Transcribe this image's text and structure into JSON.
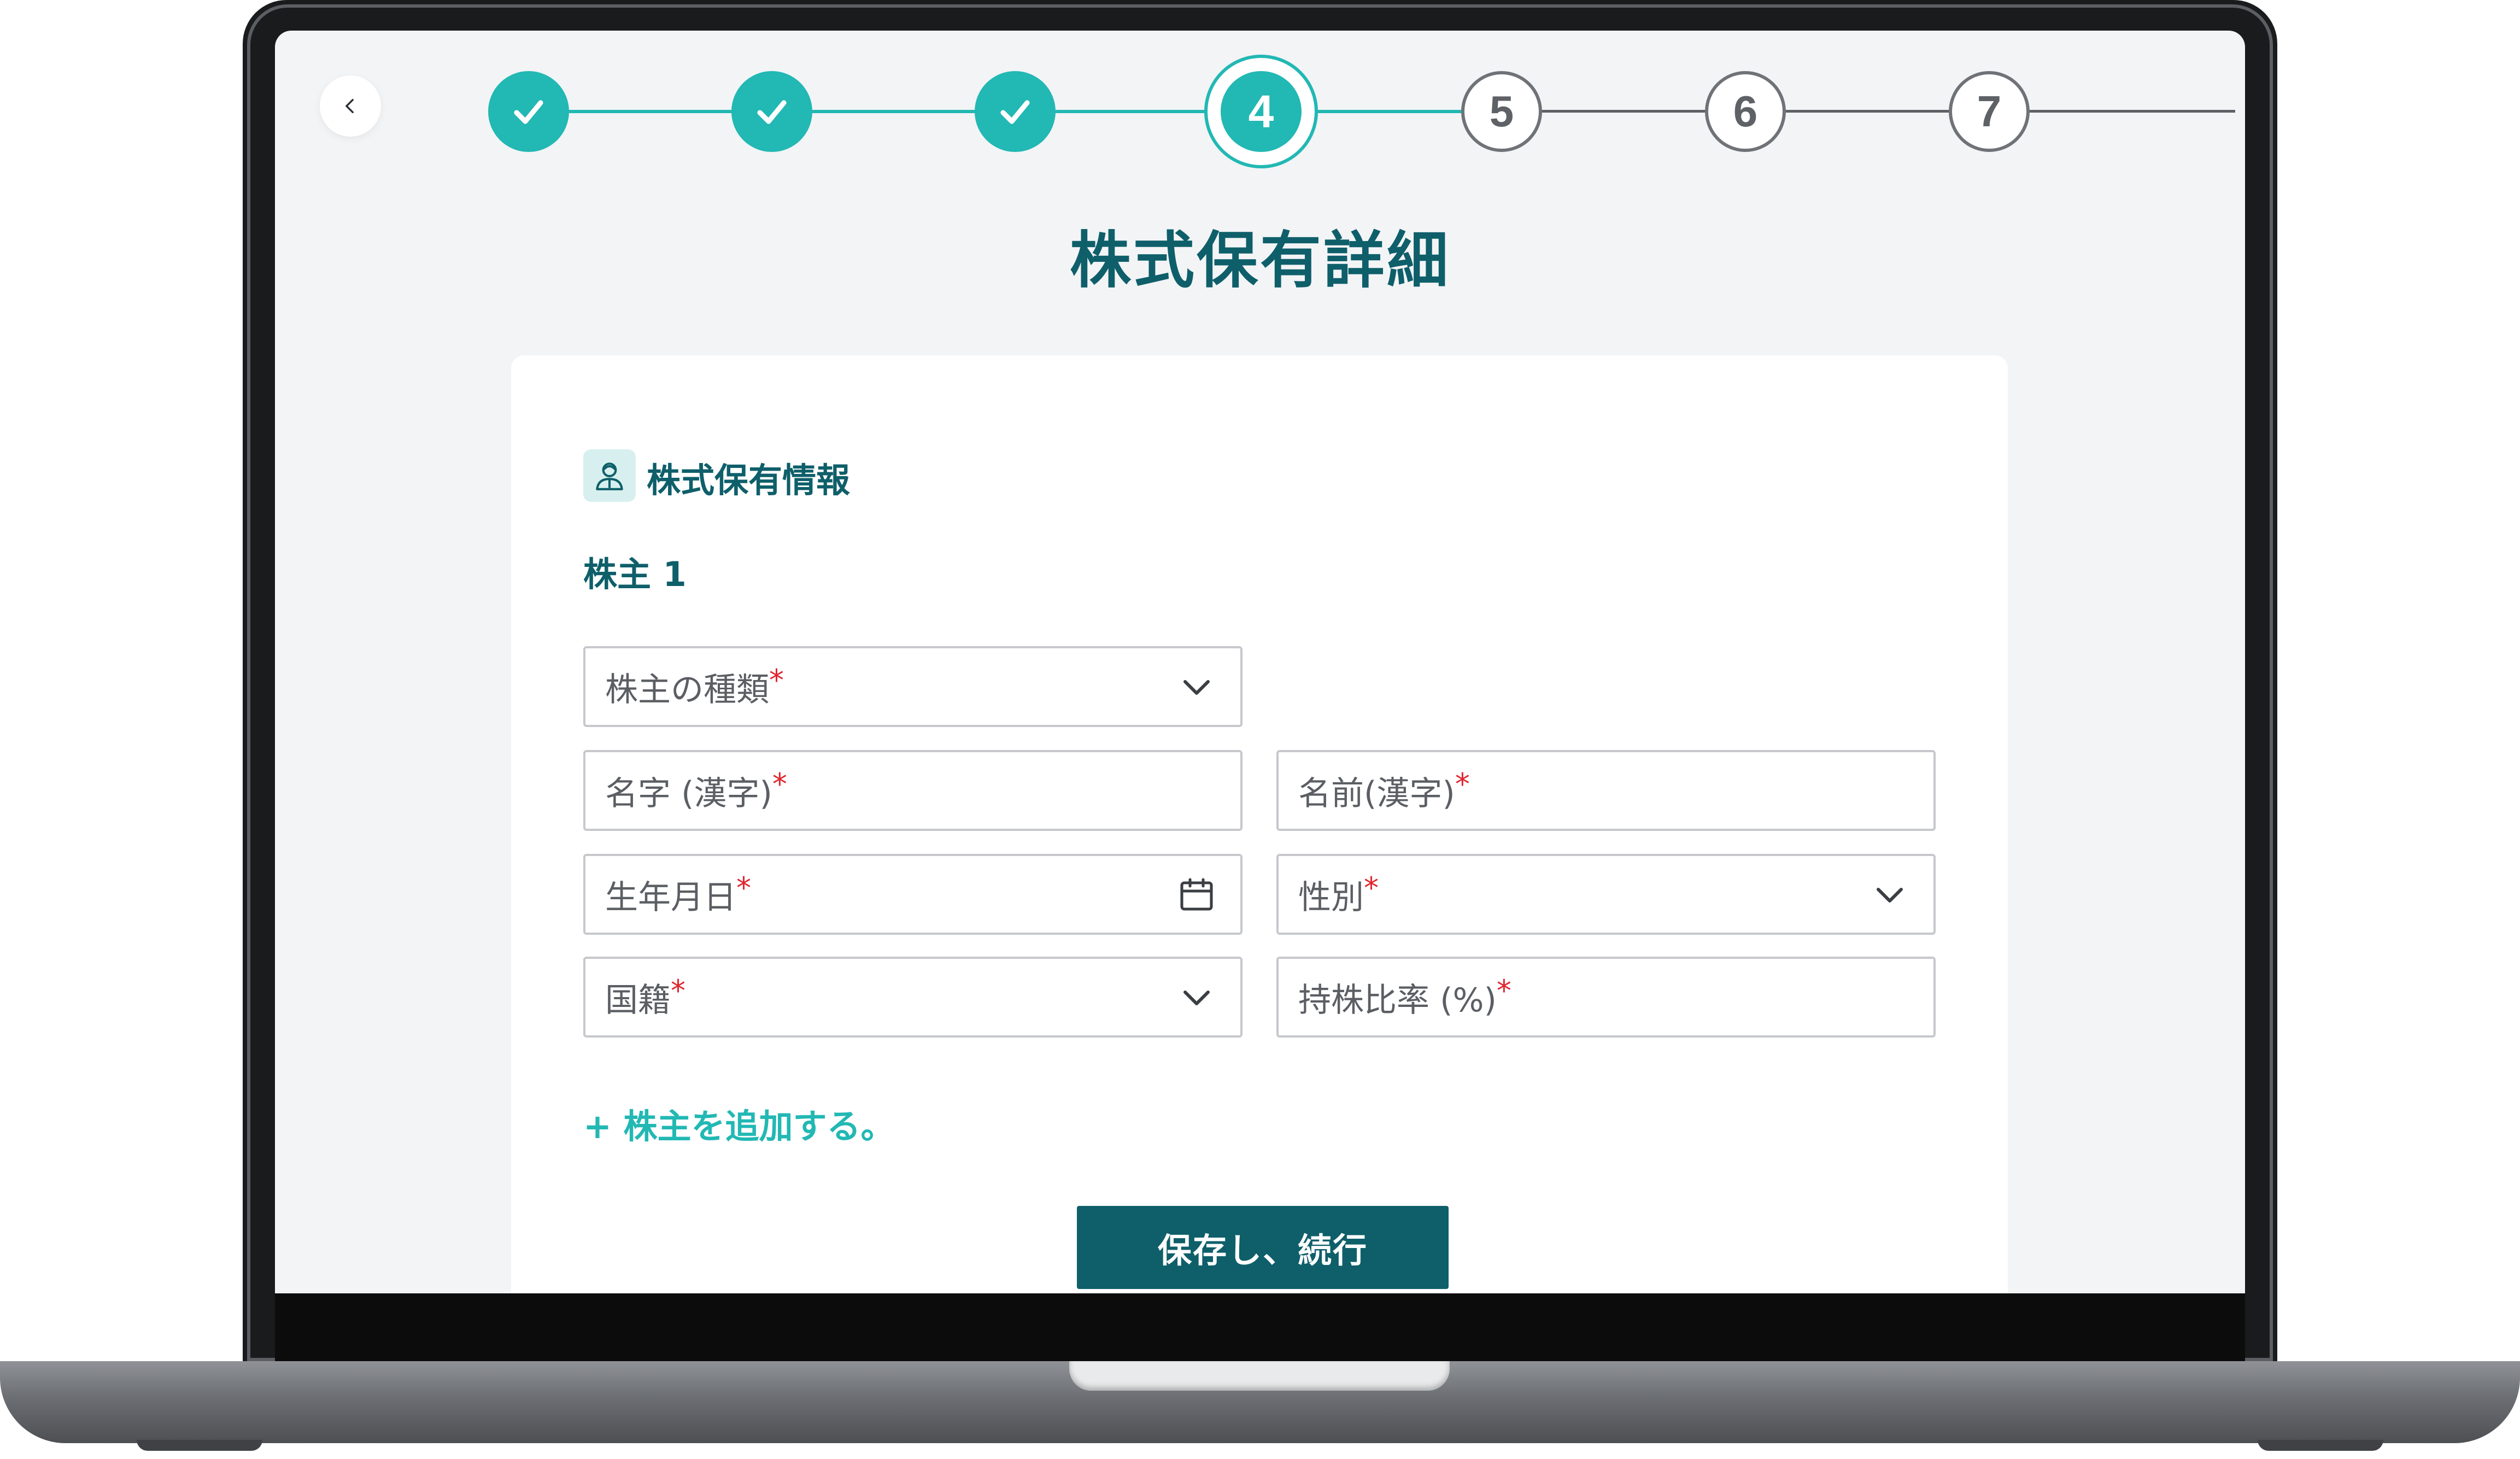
{
  "stepper": {
    "active_number": "4",
    "todo_numbers": [
      "5",
      "6",
      "7"
    ],
    "accent_color": "#22b8b4",
    "completed_count": 3
  },
  "page": {
    "title": "株式保有詳細"
  },
  "section": {
    "title": "株式保有情報",
    "icon": "person-id-icon"
  },
  "holder": {
    "label": "株主 1"
  },
  "fields": {
    "shareholder_type": {
      "label": "株主の種類",
      "required": "*"
    },
    "last_name_kanji": {
      "label": "名字 (漢字)",
      "required": "*"
    },
    "first_name_kanji": {
      "label": "名前(漢字)",
      "required": "*"
    },
    "birth_date": {
      "label": "生年月日",
      "required": "*"
    },
    "gender": {
      "label": "性別",
      "required": "*"
    },
    "nationality": {
      "label": "国籍",
      "required": "*"
    },
    "ownership_ratio": {
      "label": "持株比率 (%)",
      "required": "*"
    }
  },
  "actions": {
    "add_holder": "+ 株主を追加する。",
    "save_continue": "保存し、続行"
  },
  "colors": {
    "brand_dark": "#0e5f6a",
    "required": "#e0262f"
  }
}
